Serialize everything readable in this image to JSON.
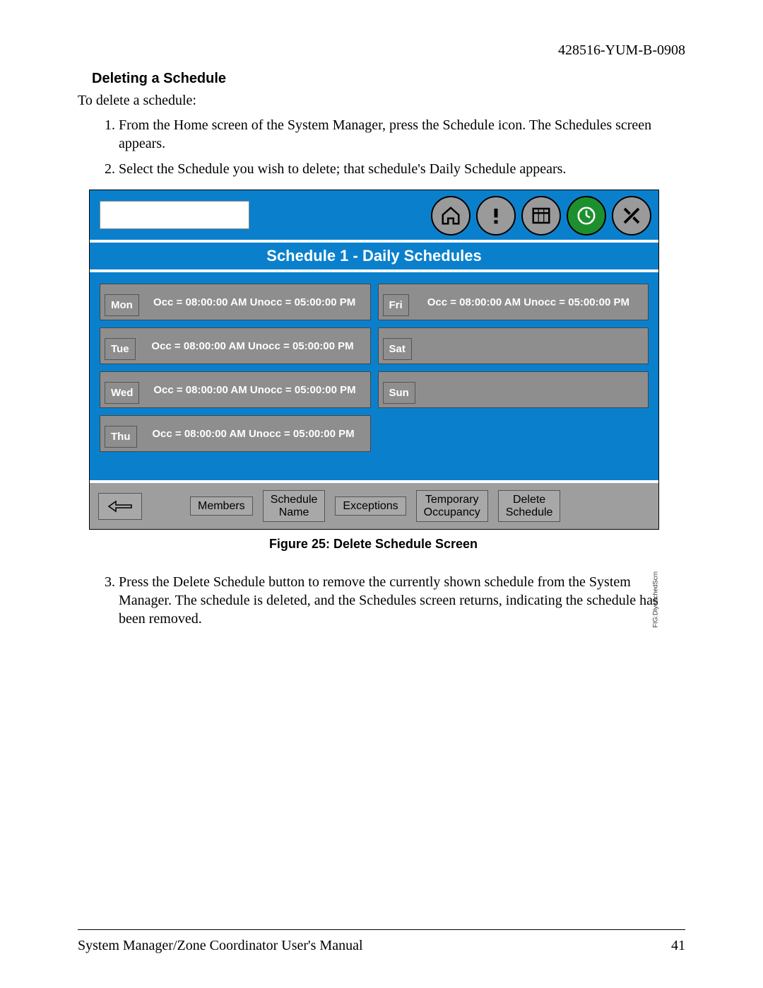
{
  "doc_id": "428516-YUM-B-0908",
  "section": {
    "title": "Deleting a Schedule",
    "intro": "To delete a schedule:",
    "steps_a": [
      "From the Home screen of the System Manager, press the Schedule icon. The Schedules screen appears.",
      "Select the Schedule you wish to delete; that schedule's Daily Schedule appears."
    ],
    "steps_b": [
      "Press the Delete Schedule button to remove the currently shown schedule from the System Manager. The schedule is deleted, and the Schedules screen returns, indicating the schedule has been removed."
    ]
  },
  "figure": {
    "title_bar": "Schedule 1 - Daily Schedules",
    "days_left": [
      {
        "label": "Mon",
        "text": "Occ = 08:00:00 AM Unocc = 05:00:00 PM"
      },
      {
        "label": "Tue",
        "text": "Occ = 08:00:00 AM Unocc = 05:00:00 PM"
      },
      {
        "label": "Wed",
        "text": "Occ = 08:00:00 AM Unocc = 05:00:00 PM"
      },
      {
        "label": "Thu",
        "text": "Occ = 08:00:00 AM Unocc = 05:00:00 PM"
      }
    ],
    "days_right": [
      {
        "label": "Fri",
        "text": "Occ = 08:00:00 AM Unocc = 05:00:00 PM"
      },
      {
        "label": "Sat",
        "text": ""
      },
      {
        "label": "Sun",
        "text": ""
      }
    ],
    "buttons": {
      "members": "Members",
      "schedule_name": "Schedule\nName",
      "exceptions": "Exceptions",
      "temp_occ": "Temporary\nOccupancy",
      "delete": "Delete\nSchedule"
    },
    "sidetext": "FIG:DlyeSchedScrn",
    "caption": "Figure 25: Delete Schedule Screen"
  },
  "footer": {
    "left": "System Manager/Zone Coordinator User's Manual",
    "right": "41"
  }
}
